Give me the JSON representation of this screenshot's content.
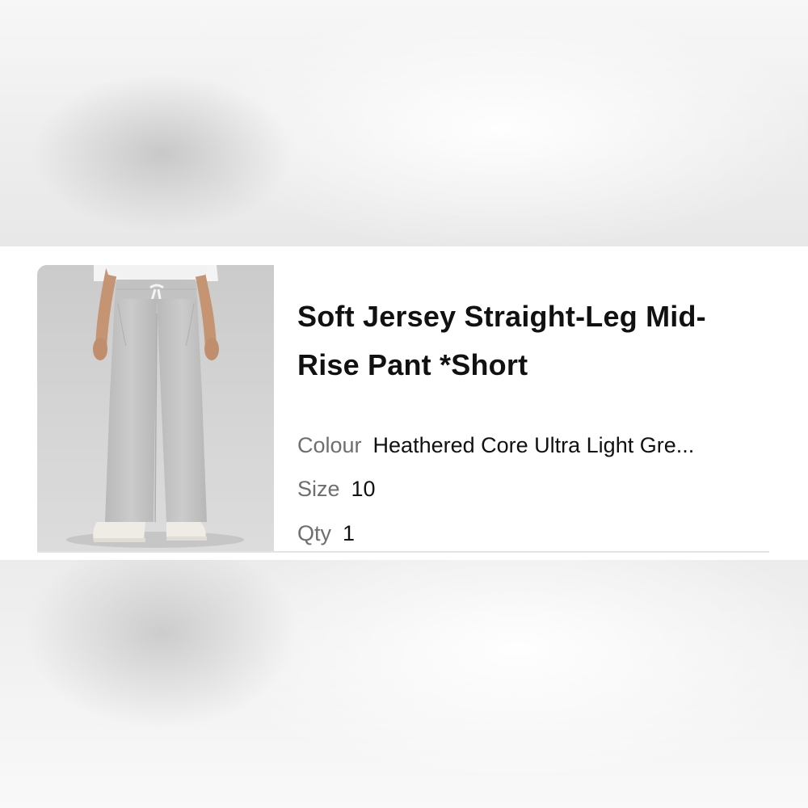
{
  "product": {
    "title": "Soft Jersey Straight-Leg Mid-Rise Pant *Short",
    "image_alt": "Soft Jersey Straight-Leg Mid-Rise Pant *Short",
    "attributes": [
      {
        "label": "Colour",
        "value": "Heathered Core Ultra Light Gre..."
      },
      {
        "label": "Size",
        "value": "10"
      },
      {
        "label": "Qty",
        "value": "1"
      }
    ]
  },
  "colors": {
    "pant": "#c4c4c4",
    "background_photo": "#d5d5d5",
    "sneaker": "#efece6",
    "text_primary": "#111111",
    "text_secondary": "#6e6e6e"
  }
}
